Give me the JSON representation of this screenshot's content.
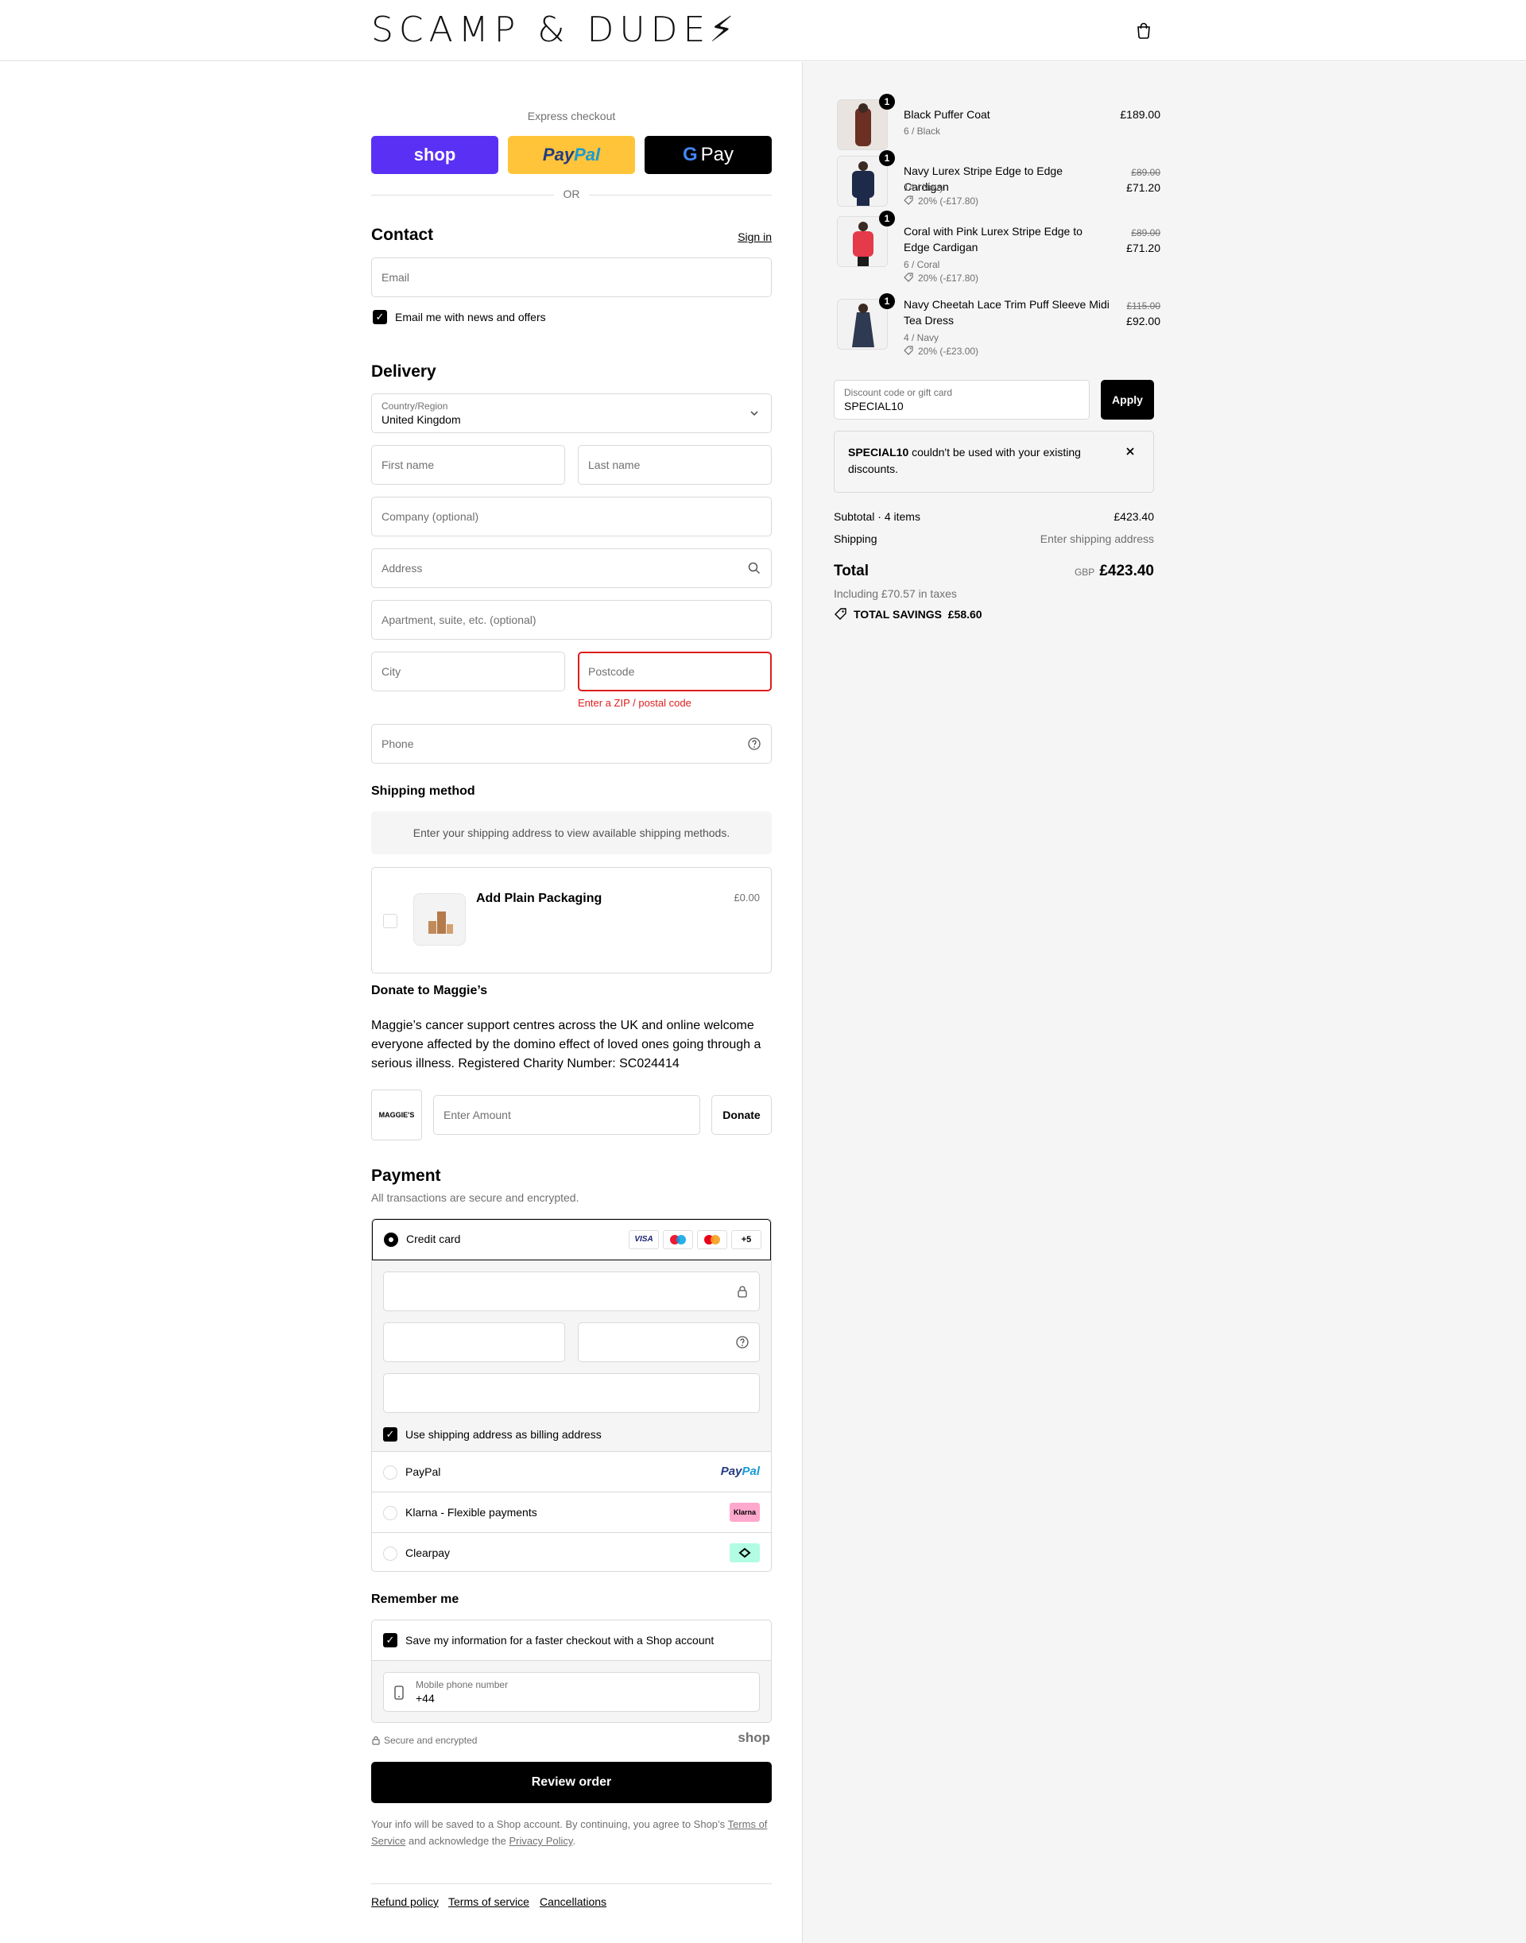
{
  "header": {
    "logo": "SCAMP & DUDE",
    "logo_mark": "⚡"
  },
  "express": {
    "title": "Express checkout",
    "shop_label": "shop",
    "paypal_a": "Pay",
    "paypal_b": "Pal",
    "gpay_g": "G",
    "gpay_label": "Pay",
    "or_label": "OR"
  },
  "contact": {
    "title": "Contact",
    "sign_in": "Sign in",
    "email_placeholder": "Email",
    "news_label": "Email me with news and offers"
  },
  "delivery": {
    "title": "Delivery",
    "country_label": "Country/Region",
    "country_value": "United Kingdom",
    "first_name": "First name",
    "last_name": "Last name",
    "company": "Company (optional)",
    "address": "Address",
    "apartment": "Apartment, suite, etc. (optional)",
    "city": "City",
    "postcode": "Postcode",
    "postcode_error": "Enter a ZIP / postal code",
    "phone": "Phone"
  },
  "shipping": {
    "title": "Shipping method",
    "notice": "Enter your shipping address to view available shipping methods."
  },
  "packaging": {
    "title": "Add Plain Packaging",
    "price": "£0.00"
  },
  "donate": {
    "title": "Donate to Maggie’s",
    "text": "Maggie’s cancer support centres across the UK and online welcome everyone affected by the domino effect of loved ones going through a serious illness. Registered Charity Number: SC024414",
    "logo_text": "MAGGIE'S",
    "amount_placeholder": "Enter Amount",
    "button": "Donate"
  },
  "payment": {
    "title": "Payment",
    "subtitle": "All transactions are secure and encrypted.",
    "credit_card": "Credit card",
    "card_brands": [
      "VISA",
      "+5"
    ],
    "billing_label": "Use shipping address as billing address",
    "paypal": "PayPal",
    "paypal_logo_a": "Pay",
    "paypal_logo_b": "Pal",
    "klarna": "Klarna - Flexible payments",
    "klarna_logo": "Klarna",
    "clearpay": "Clearpay"
  },
  "remember": {
    "title": "Remember me",
    "save_label": "Save my information for a faster checkout with a Shop account",
    "phone_label": "Mobile phone number",
    "phone_value": "+44",
    "secure": "Secure and encrypted",
    "shop_logo": "shop"
  },
  "review_button": "Review order",
  "legal": {
    "text_a": "Your info will be saved to a Shop account. By continuing, you agree to Shop’s",
    "terms": "Terms of Service",
    "text_b": "and acknowledge the",
    "privacy": "Privacy Policy",
    "text_c": "."
  },
  "footer_links": [
    "Refund policy",
    "Terms of service",
    "Cancellations"
  ],
  "summary": {
    "items": [
      {
        "qty": "1",
        "name": "Black Puffer Coat",
        "variant": "6 / Black",
        "price": "£189.00",
        "original": "",
        "discount": ""
      },
      {
        "qty": "1",
        "name": "Navy Lurex Stripe Edge to Edge Cardigan",
        "variant": "14 / Navy",
        "price": "£71.20",
        "original": "£89.00",
        "discount": "20% (-£17.80)"
      },
      {
        "qty": "1",
        "name": "Coral with Pink Lurex Stripe Edge to Edge Cardigan",
        "variant": "6 / Coral",
        "price": "£71.20",
        "original": "£89.00",
        "discount": "20% (-£17.80)"
      },
      {
        "qty": "1",
        "name": "Navy Cheetah Lace Trim Puff Sleeve Midi Tea Dress",
        "variant": "4 / Navy",
        "price": "£92.00",
        "original": "£115.00",
        "discount": "20% (-£23.00)"
      }
    ],
    "discount_label": "Discount code or gift card",
    "discount_value": "SPECIAL10",
    "apply": "Apply",
    "error_code": "SPECIAL10",
    "error_text": "couldn't be used with your existing discounts.",
    "subtotal_label": "Subtotal · 4 items",
    "subtotal_value": "£423.40",
    "shipping_label": "Shipping",
    "shipping_value": "Enter shipping address",
    "total_label": "Total",
    "currency": "GBP",
    "total_value": "£423.40",
    "taxes": "Including £70.57 in taxes",
    "savings_label": "TOTAL SAVINGS",
    "savings_value": "£58.60"
  }
}
